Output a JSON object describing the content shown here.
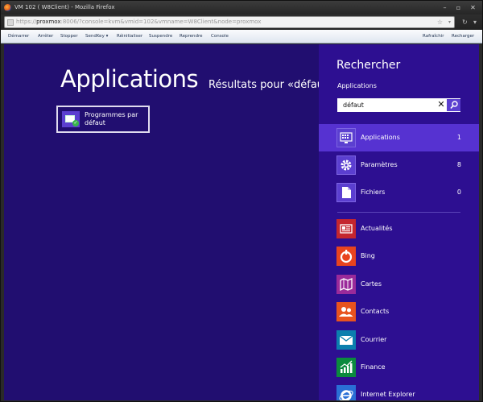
{
  "window": {
    "title": "VM 102 ( W8Client) - Mozilla Firefox",
    "minimize_glyph": "–",
    "restore_glyph": "▫",
    "close_glyph": "✕"
  },
  "urlbar": {
    "url_prefix": "https://",
    "url_host": "proxmox",
    "url_rest": ":8006/?console=kvm&vmid=102&vmname=W8Client&node=proxmox",
    "star_glyph": "☆",
    "dropdown_glyph": "▾",
    "reload_glyph": "↻",
    "menu_glyph": "▾"
  },
  "toolbar": {
    "items": [
      "Démarrer",
      "Arrêter",
      "Stopper",
      "SendKey ▾",
      "Réinitialiser",
      "Suspendre",
      "Reprendre",
      "Console"
    ],
    "right_items": [
      "Rafraîchir",
      "Recharger"
    ]
  },
  "vm": {
    "heading": "Applications",
    "results_text": "Résultats pour «défaut»",
    "tile": {
      "label": "Programmes par défaut",
      "icon": "default-programs-icon"
    }
  },
  "search_pane": {
    "title": "Rechercher",
    "scope": "Applications",
    "query": "défaut",
    "clear_glyph": "✕",
    "categories": [
      {
        "label": "Applications",
        "count": "1",
        "icon": "keyboard-icon",
        "selected": true
      },
      {
        "label": "Paramètres",
        "count": "8",
        "icon": "gear-icon",
        "selected": false
      },
      {
        "label": "Fichiers",
        "count": "0",
        "icon": "document-icon",
        "selected": false
      }
    ],
    "apps": [
      {
        "label": "Actualités",
        "icon": "news-icon",
        "color": "#c4262e"
      },
      {
        "label": "Bing",
        "icon": "bing-icon",
        "color": "#e8441f"
      },
      {
        "label": "Cartes",
        "icon": "maps-icon",
        "color": "#9a2a9a"
      },
      {
        "label": "Contacts",
        "icon": "contacts-icon",
        "color": "#e8531f"
      },
      {
        "label": "Courrier",
        "icon": "mail-icon",
        "color": "#0b7fae"
      },
      {
        "label": "Finance",
        "icon": "finance-icon",
        "color": "#0b8a3e"
      },
      {
        "label": "Internet Explorer",
        "icon": "ie-icon",
        "color": "#2a6fd6"
      }
    ]
  }
}
